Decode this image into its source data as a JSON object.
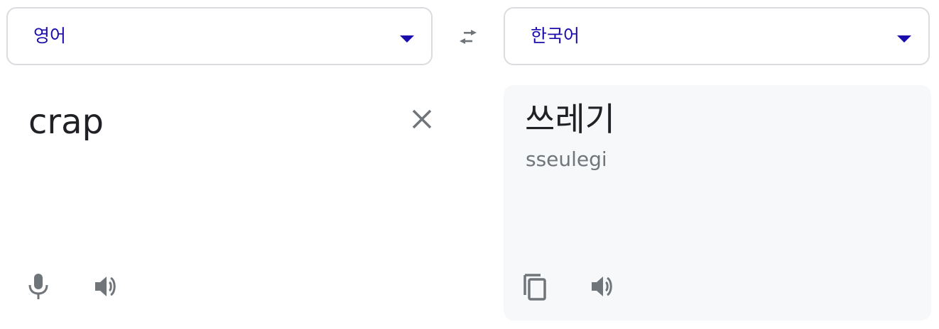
{
  "source_language": {
    "label": "영어"
  },
  "target_language": {
    "label": "한국어"
  },
  "source": {
    "text": "crap"
  },
  "target": {
    "text": "쓰레기",
    "romanization": "sseulegi"
  },
  "icons": {
    "dropdown": "caret-down-icon",
    "swap": "swap-arrows-icon",
    "clear": "close-icon",
    "mic": "microphone-icon",
    "speaker": "speaker-icon",
    "copy": "copy-icon"
  },
  "colors": {
    "language_label": "#1a0dab",
    "icon_gray": "#70757a",
    "target_background": "#f7f8fa",
    "border": "#dadce0"
  }
}
